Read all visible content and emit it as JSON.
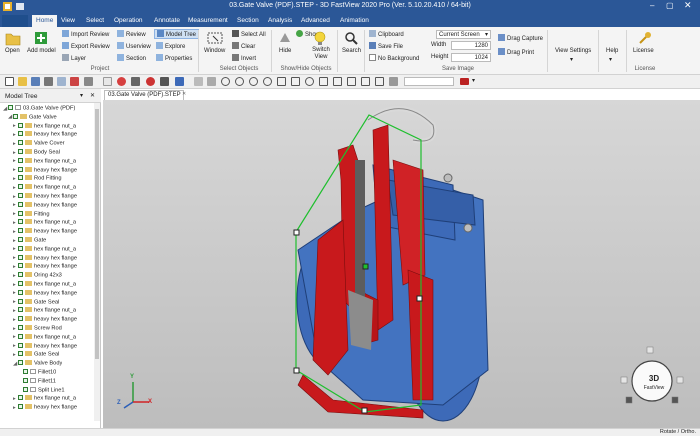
{
  "window": {
    "title": "03.Gate Valve (PDF).STEP - 3D FastView 2020 Pro (Ver. 5.10.20.410 / 64-bit)"
  },
  "tabs": [
    "Home",
    "View",
    "Select",
    "Operation",
    "Annotate",
    "Measurement",
    "Section",
    "Analysis",
    "Advanced",
    "Animation"
  ],
  "ribbon": {
    "project": {
      "open": "Open",
      "add_model": "Add model",
      "import_review": "Import Review",
      "export_review": "Export Review",
      "layer": "Layer",
      "review": "Review",
      "userview": "Userview",
      "section": "Section",
      "model_tree": "Model Tree",
      "explore": "Explore",
      "properties": "Properties",
      "group": "Project"
    },
    "select_objects": {
      "window": "Window",
      "select_all": "Select All",
      "clear": "Clear",
      "invert": "Invert",
      "group": "Select Objects"
    },
    "show_hide": {
      "hide": "Hide",
      "show": "Show",
      "switch_view": "Switch View",
      "group": "Show/Hide Objects"
    },
    "search": {
      "label": "Search"
    },
    "save_image": {
      "clipboard": "Clipboard",
      "save_file": "Save File",
      "no_background": "No Background",
      "screen_mode": "Current Screen",
      "width_label": "Width",
      "width_value": "1280",
      "height_label": "Height",
      "height_value": "1024",
      "group": "Save Image"
    },
    "drag": {
      "capture": "Drag Capture",
      "print": "Drag Print"
    },
    "view_settings": "View Settings",
    "help": "Help",
    "license": {
      "label": "License",
      "group": "License"
    }
  },
  "left_panel": {
    "title": "Model Tree",
    "items": [
      {
        "level": 0,
        "label": "03.Gate Valve (PDF)",
        "icon": "file",
        "expand": "◢"
      },
      {
        "level": 1,
        "label": "Gate Valve",
        "icon": "part",
        "expand": "◢"
      },
      {
        "level": 2,
        "label": "hex flange nut_a",
        "icon": "part",
        "expand": "▸"
      },
      {
        "level": 2,
        "label": "heavy hex flange",
        "icon": "part",
        "expand": "▸"
      },
      {
        "level": 2,
        "label": "Valve Cover",
        "icon": "part",
        "expand": "▸"
      },
      {
        "level": 2,
        "label": "Body Seal",
        "icon": "part",
        "expand": "▸"
      },
      {
        "level": 2,
        "label": "hex flange nut_a",
        "icon": "part",
        "expand": "▸"
      },
      {
        "level": 2,
        "label": "heavy hex flange",
        "icon": "part",
        "expand": "▸"
      },
      {
        "level": 2,
        "label": "Rod Fitting",
        "icon": "part",
        "expand": "▸"
      },
      {
        "level": 2,
        "label": "hex flange nut_a",
        "icon": "part",
        "expand": "▸"
      },
      {
        "level": 2,
        "label": "heavy hex flange",
        "icon": "part",
        "expand": "▸"
      },
      {
        "level": 2,
        "label": "heavy hex flange",
        "icon": "part",
        "expand": "▸"
      },
      {
        "level": 2,
        "label": "Fitting",
        "icon": "part",
        "expand": "▸"
      },
      {
        "level": 2,
        "label": "hex flange nut_a",
        "icon": "part",
        "expand": "▸"
      },
      {
        "level": 2,
        "label": "heavy hex flange",
        "icon": "part",
        "expand": "▸"
      },
      {
        "level": 2,
        "label": "Gate",
        "icon": "part",
        "expand": "▸"
      },
      {
        "level": 2,
        "label": "hex flange nut_a",
        "icon": "part",
        "expand": "▸"
      },
      {
        "level": 2,
        "label": "heavy hex flange",
        "icon": "part",
        "expand": "▸"
      },
      {
        "level": 2,
        "label": "heavy hex flange",
        "icon": "part",
        "expand": "▸"
      },
      {
        "level": 2,
        "label": "Oring 42x3",
        "icon": "part",
        "expand": "▸"
      },
      {
        "level": 2,
        "label": "hex flange nut_a",
        "icon": "part",
        "expand": "▸"
      },
      {
        "level": 2,
        "label": "heavy hex flange",
        "icon": "part",
        "expand": "▸"
      },
      {
        "level": 2,
        "label": "Gate Seal",
        "icon": "part",
        "expand": "▸"
      },
      {
        "level": 2,
        "label": "hex flange nut_a",
        "icon": "part",
        "expand": "▸"
      },
      {
        "level": 2,
        "label": "heavy hex flange",
        "icon": "part",
        "expand": "▸"
      },
      {
        "level": 2,
        "label": "Screw Rod",
        "icon": "part",
        "expand": "▸"
      },
      {
        "level": 2,
        "label": "hex flange nut_a",
        "icon": "part",
        "expand": "▸"
      },
      {
        "level": 2,
        "label": "heavy hex flange",
        "icon": "part",
        "expand": "▸"
      },
      {
        "level": 2,
        "label": "Gate Seal",
        "icon": "part",
        "expand": "▸"
      },
      {
        "level": 2,
        "label": "Valve Body",
        "icon": "part",
        "expand": "◢"
      },
      {
        "level": 3,
        "label": "Fillet10",
        "icon": "feature",
        "expand": ""
      },
      {
        "level": 3,
        "label": "Fillet11",
        "icon": "feature",
        "expand": ""
      },
      {
        "level": 3,
        "label": "Split Line1",
        "icon": "feature",
        "expand": ""
      },
      {
        "level": 2,
        "label": "hex flange nut_a",
        "icon": "part",
        "expand": "▸"
      },
      {
        "level": 2,
        "label": "heavy hex flange",
        "icon": "part",
        "expand": "▸"
      }
    ]
  },
  "document_tab": "03.Gate Valve (PDF).STEP",
  "viewcube": {
    "line1": "3D",
    "line2": "FastView"
  },
  "axes": {
    "x": "X",
    "y": "Y",
    "z": "Z"
  },
  "status": {
    "right": "Rotate / Ortho."
  },
  "colors": {
    "titlebar": "#2b5797",
    "valve_body": "#3d6ab8",
    "section_cut": "#c8191c",
    "ribbon": "#f4f4f4"
  }
}
